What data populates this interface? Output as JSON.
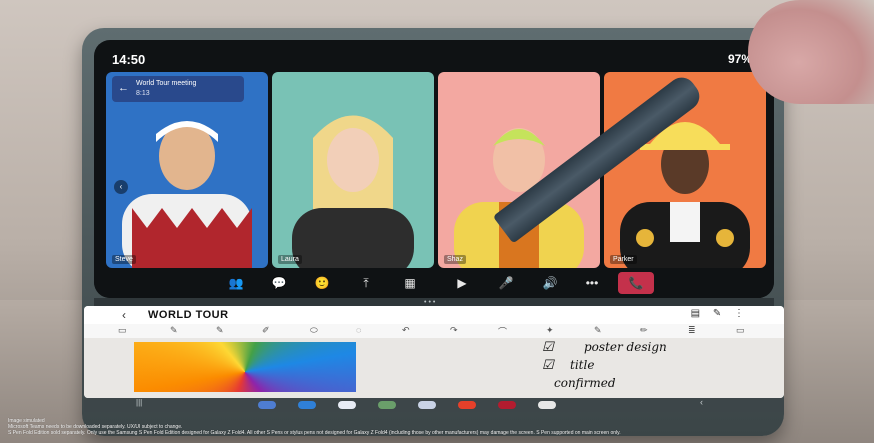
{
  "status": {
    "time": "14:50",
    "battery": "97%"
  },
  "meeting": {
    "title": "World Tour meeting",
    "duration": "8:13"
  },
  "participants": [
    {
      "name": "Steve",
      "bg": "#2f72c5"
    },
    {
      "name": "Laura",
      "bg": "#79c2b5"
    },
    {
      "name": "Shaz",
      "bg": "#f3a8a1"
    },
    {
      "name": "Parker",
      "bg": "#f07a43"
    }
  ],
  "call_controls": {
    "participants": "👥",
    "chat": "💬",
    "reactions": "🙂",
    "share": "⤒",
    "apps": "▦",
    "camera": "▶",
    "mic": "🎤",
    "speaker": "🔊",
    "more": "•••",
    "end": "📞"
  },
  "notes": {
    "back": "‹",
    "title": "WORLD TOUR",
    "actions": [
      "▤",
      "✎",
      "⋮"
    ],
    "handwriting": [
      "poster design",
      "title",
      "confirmed"
    ],
    "checks": [
      "☑",
      "☑"
    ]
  },
  "toolbar_tools": [
    "▭",
    "✎",
    "✎",
    "✐",
    "⬭",
    "◌",
    "↶",
    "↷",
    "⌒",
    "✦",
    "✎",
    "✏",
    "≣",
    "▭"
  ],
  "taskbar": {
    "left": "|||",
    "right": "‹",
    "app_colors": [
      "#4e7dd1",
      "#2f80d8",
      "#e8ecf5",
      "#6a9e6a",
      "#c9d3e6",
      "#e6402a",
      "#b31c2f",
      "#e8e8e8"
    ]
  },
  "disclaimer": [
    "Image simulated",
    "Microsoft Teams needs to be downloaded separately. UX/UI subject to change.",
    "S Pen Fold Edition sold separately. Only use the Samsung S Pen Fold Edition designed for Galaxy Z Fold4. All other S Pens or stylus pens not designed for Galaxy Z Fold4 (including those by other manufacturers) may damage the screen. S Pen supported on main screen only."
  ]
}
